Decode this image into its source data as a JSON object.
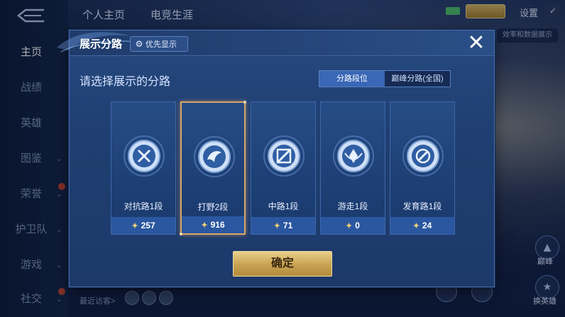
{
  "topbar": {
    "tabs": [
      "个人主页",
      "电竞生涯"
    ],
    "settings_label": "设置",
    "data_show_chip": "效率和数据展示"
  },
  "sidebar": {
    "items": [
      {
        "label": "主页",
        "active": true
      },
      {
        "label": "战绩"
      },
      {
        "label": "英雄"
      },
      {
        "label": "图鉴",
        "chevron": true
      },
      {
        "label": "荣誉",
        "chevron": true,
        "badge": true
      },
      {
        "label": "护卫队",
        "chevron": true
      },
      {
        "label": "游戏",
        "chevron": true
      },
      {
        "label": "社交",
        "chevron": true,
        "badge": true
      }
    ]
  },
  "footer": {
    "recent_visitors_label": "最近访客>",
    "right_labels": [
      "巅峰",
      "换英雄"
    ]
  },
  "modal": {
    "title": "展示分路",
    "priority_button": "优先显示",
    "prompt": "请选择展示的分路",
    "segment_options": [
      {
        "label": "分路段位",
        "active": true
      },
      {
        "label": "巅峰分路(全国)",
        "active": false
      }
    ],
    "close_icon": "close-icon",
    "cards": [
      {
        "name": "对抗路1段",
        "value": "257",
        "icon": "clash-lane-icon",
        "selected": false
      },
      {
        "name": "打野2段",
        "value": "916",
        "icon": "jungle-icon",
        "selected": true
      },
      {
        "name": "中路1段",
        "value": "71",
        "icon": "mid-lane-icon",
        "selected": false
      },
      {
        "name": "游走1段",
        "value": "0",
        "icon": "roam-icon",
        "selected": false
      },
      {
        "name": "发育路1段",
        "value": "24",
        "icon": "farm-lane-icon",
        "selected": false
      }
    ],
    "confirm_label": "确定"
  },
  "colors": {
    "modal_bg": "#26497e",
    "stat_bar": "#2b57a0",
    "selected_border": "#d9a66a",
    "confirm_gold": "#c8a251",
    "segment_active": "#3a67b6"
  }
}
